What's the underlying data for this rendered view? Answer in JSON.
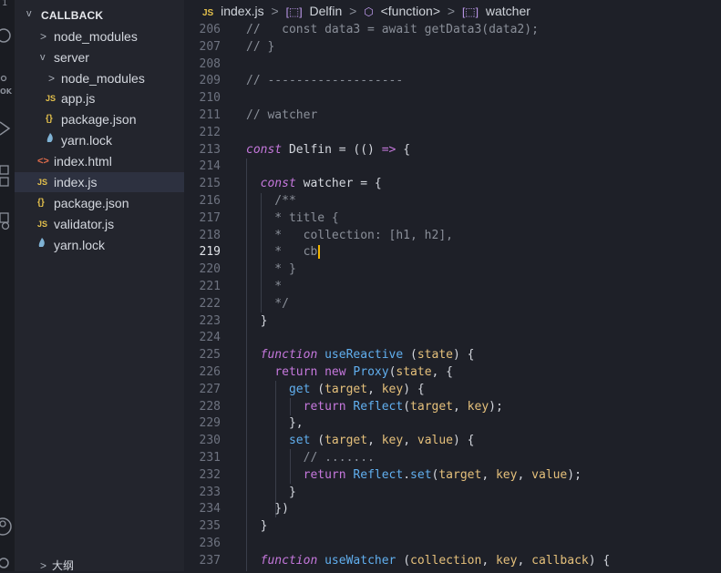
{
  "activity_bar": {
    "top_label": "1",
    "ok_label": "OK"
  },
  "explorer": {
    "title": "CALLBACK",
    "items": [
      {
        "label": "node_modules",
        "type": "folder",
        "expanded": false
      },
      {
        "label": "server",
        "type": "folder",
        "expanded": true
      },
      {
        "label": "node_modules",
        "type": "folder",
        "expanded": false
      },
      {
        "label": "app.js",
        "type": "js"
      },
      {
        "label": "package.json",
        "type": "json"
      },
      {
        "label": "yarn.lock",
        "type": "yarn"
      },
      {
        "label": "index.html",
        "type": "html"
      },
      {
        "label": "index.js",
        "type": "js",
        "active": true
      },
      {
        "label": "package.json",
        "type": "json"
      },
      {
        "label": "validator.js",
        "type": "js"
      },
      {
        "label": "yarn.lock",
        "type": "yarn"
      }
    ],
    "outline_label": "大纲",
    "icons": {
      "js": "JS",
      "json": "{}",
      "html": "<>",
      "chevron_right": ">",
      "chevron_down": "v"
    }
  },
  "breadcrumb": {
    "file": "index.js",
    "icon_text": "JS",
    "parts": [
      "Delfin",
      "<function>",
      "watcher"
    ],
    "separator": ">"
  },
  "editor": {
    "current_line": "219",
    "lines": [
      {
        "n": "206",
        "code": "//   const data3 = await getData3(data2);"
      },
      {
        "n": "207",
        "code": "// }"
      },
      {
        "n": "208",
        "code": ""
      },
      {
        "n": "209",
        "code": "// -------------------"
      },
      {
        "n": "210",
        "code": ""
      },
      {
        "n": "211",
        "code": "// watcher"
      },
      {
        "n": "212",
        "code": ""
      },
      {
        "n": "213",
        "code": "const Delfin = (() => {"
      },
      {
        "n": "214",
        "code": ""
      },
      {
        "n": "215",
        "code": "  const watcher = {"
      },
      {
        "n": "216",
        "code": "    /**"
      },
      {
        "n": "217",
        "code": "    * title {"
      },
      {
        "n": "218",
        "code": "    *   collection: [h1, h2],"
      },
      {
        "n": "219",
        "code": "    *   cb"
      },
      {
        "n": "220",
        "code": "    * }"
      },
      {
        "n": "221",
        "code": "    *"
      },
      {
        "n": "222",
        "code": "    */"
      },
      {
        "n": "223",
        "code": "  }"
      },
      {
        "n": "224",
        "code": ""
      },
      {
        "n": "225",
        "code": "  function useReactive (state) {"
      },
      {
        "n": "226",
        "code": "    return new Proxy(state, {"
      },
      {
        "n": "227",
        "code": "      get (target, key) {"
      },
      {
        "n": "228",
        "code": "        return Reflect(target, key);"
      },
      {
        "n": "229",
        "code": "      },"
      },
      {
        "n": "230",
        "code": "      set (target, key, value) {"
      },
      {
        "n": "231",
        "code": "        // ......."
      },
      {
        "n": "232",
        "code": "        return Reflect.set(target, key, value);"
      },
      {
        "n": "233",
        "code": "      }"
      },
      {
        "n": "234",
        "code": "    })"
      },
      {
        "n": "235",
        "code": "  }"
      },
      {
        "n": "236",
        "code": ""
      },
      {
        "n": "237",
        "code": "  function useWatcher (collection, key, callback) {"
      }
    ]
  }
}
